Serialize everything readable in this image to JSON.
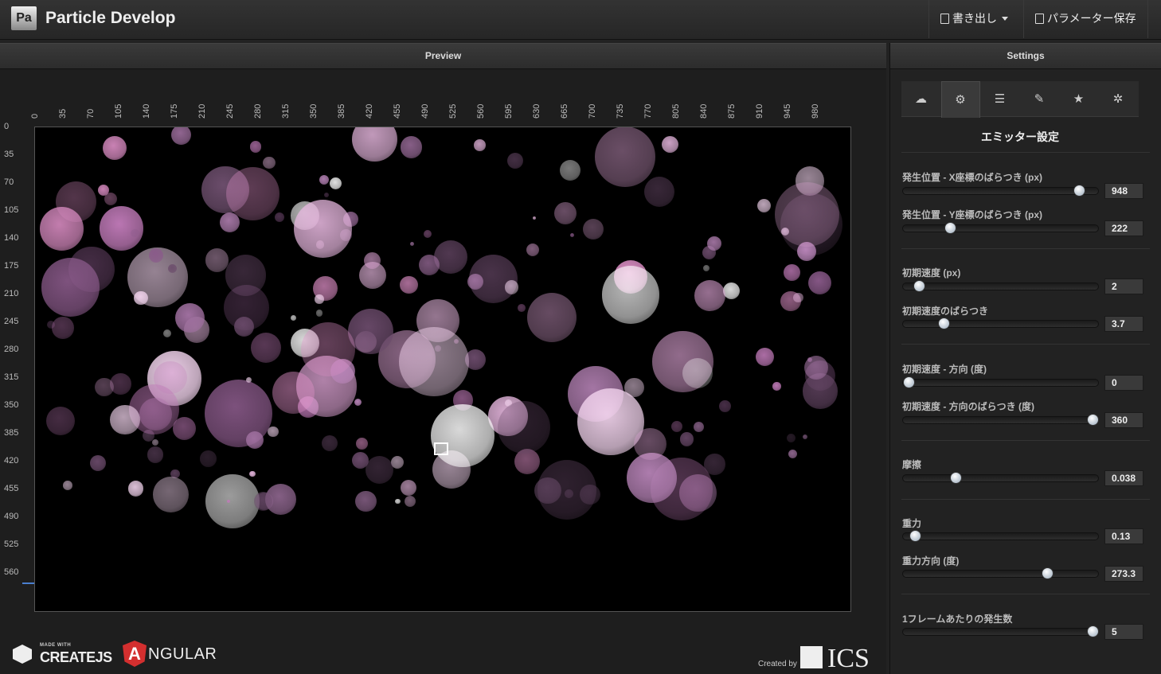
{
  "app": {
    "title": "Particle Develop",
    "logo_text": "Pa"
  },
  "toolbar": {
    "export_label": "書き出し",
    "save_label": "パラメーター保存"
  },
  "preview": {
    "title": "Preview",
    "x_ticks": [
      "0",
      "35",
      "70",
      "105",
      "140",
      "175",
      "210",
      "245",
      "280",
      "315",
      "350",
      "385",
      "420",
      "455",
      "490",
      "525",
      "560",
      "595",
      "630",
      "665",
      "700",
      "735",
      "770",
      "805",
      "840",
      "875",
      "910",
      "945",
      "980"
    ],
    "y_ticks": [
      "0",
      "35",
      "70",
      "105",
      "140",
      "175",
      "210",
      "245",
      "280",
      "315",
      "350",
      "385",
      "420",
      "455",
      "490",
      "525",
      "560"
    ],
    "credits": {
      "createjs_small": "MADE WITH",
      "createjs": "CREATEJS",
      "angular": "NGULAR",
      "angular_mark": "A",
      "created_by": "Created by",
      "ics": "ICS"
    }
  },
  "settings": {
    "title": "Settings",
    "tabs": [
      {
        "icon": "cloud-icon",
        "glyph": "☁"
      },
      {
        "icon": "gears-icon",
        "glyph": "⚙"
      },
      {
        "icon": "sliders-icon",
        "glyph": "☰"
      },
      {
        "icon": "brush-icon",
        "glyph": "✎"
      },
      {
        "icon": "star-icon",
        "glyph": "★"
      },
      {
        "icon": "gear-icon",
        "glyph": "✲"
      }
    ],
    "section_title": "エミッター設定",
    "params": [
      {
        "label": "発生位置 - X座標のばらつき (px)",
        "value": "948",
        "level": 0.9
      },
      {
        "label": "発生位置 - Y座標のばらつき (px)",
        "value": "222",
        "level": 0.24
      },
      {
        "label": "初期速度 (px)",
        "value": "2",
        "level": 0.08
      },
      {
        "label": "初期速度のばらつき",
        "value": "3.7",
        "level": 0.21
      },
      {
        "label": "初期速度 - 方向 (度)",
        "value": "0",
        "level": 0.03
      },
      {
        "label": "初期速度 - 方向のばらつき (度)",
        "value": "360",
        "level": 0.97
      },
      {
        "label": "摩擦",
        "value": "0.038",
        "level": 0.27
      },
      {
        "label": "重力",
        "value": "0.13",
        "level": 0.06
      },
      {
        "label": "重力方向 (度)",
        "value": "273.3",
        "level": 0.74
      },
      {
        "label": "1フレームあたりの発生数",
        "value": "5",
        "level": 0.97
      }
    ]
  }
}
